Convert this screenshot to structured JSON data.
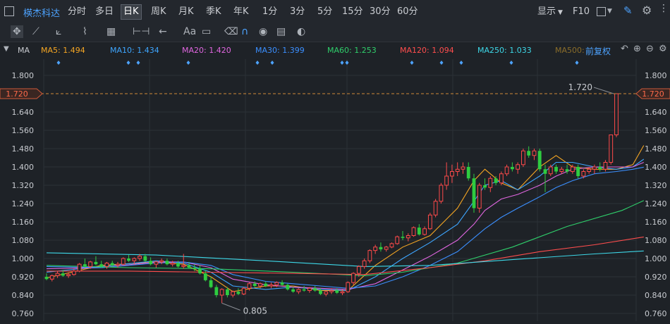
{
  "header": {
    "stock_name": "楧杰科达",
    "periods": [
      "分时",
      "多日",
      "日K",
      "周K",
      "月K",
      "季K",
      "年K",
      "1分",
      "3分",
      "5分",
      "15分",
      "30分",
      "60分"
    ],
    "active_period": "日K",
    "display_label": "显示",
    "f10_label": "F10"
  },
  "toolbar": {
    "text_tool_label": "Aa"
  },
  "indicators": {
    "ma_label": "MA",
    "items": [
      {
        "label": "MA5: 1.494",
        "color": "#f5a623"
      },
      {
        "label": "MA10: 1.434",
        "color": "#3ea6ff"
      },
      {
        "label": "MA20: 1.420",
        "color": "#e066e0"
      },
      {
        "label": "MA30: 1.399",
        "color": "#3b8fff"
      },
      {
        "label": "MA60: 1.253",
        "color": "#2fcf6b"
      },
      {
        "label": "MA120: 1.094",
        "color": "#ff4d4d"
      },
      {
        "label": "MA250: 1.033",
        "color": "#3dd8e8"
      },
      {
        "label": "MA500:",
        "color": "#8a6d2a"
      }
    ],
    "adjust_label": "前复权"
  },
  "chart_data": {
    "type": "candlestick",
    "y_ticks": [
      "1.800",
      "1.720",
      "1.640",
      "1.560",
      "1.480",
      "1.400",
      "1.320",
      "1.240",
      "1.160",
      "1.080",
      "1.000",
      "0.920",
      "0.840",
      "0.760"
    ],
    "ylim": [
      0.755,
      1.83
    ],
    "current_price_label": "1.720",
    "current_price": 1.72,
    "high_label": "1.720",
    "low_label": "0.805",
    "candles": [
      {
        "o": 0.92,
        "h": 0.935,
        "l": 0.905,
        "c": 0.91
      },
      {
        "o": 0.91,
        "h": 0.93,
        "l": 0.9,
        "c": 0.925
      },
      {
        "o": 0.925,
        "h": 0.945,
        "l": 0.915,
        "c": 0.935
      },
      {
        "o": 0.935,
        "h": 0.95,
        "l": 0.92,
        "c": 0.925
      },
      {
        "o": 0.925,
        "h": 0.94,
        "l": 0.915,
        "c": 0.93
      },
      {
        "o": 0.93,
        "h": 0.955,
        "l": 0.925,
        "c": 0.945
      },
      {
        "o": 0.945,
        "h": 0.98,
        "l": 0.94,
        "c": 0.975
      },
      {
        "o": 0.975,
        "h": 1.0,
        "l": 0.96,
        "c": 0.965
      },
      {
        "o": 0.965,
        "h": 0.99,
        "l": 0.955,
        "c": 0.985
      },
      {
        "o": 0.985,
        "h": 1.01,
        "l": 0.97,
        "c": 0.975
      },
      {
        "o": 0.975,
        "h": 0.99,
        "l": 0.96,
        "c": 0.965
      },
      {
        "o": 0.965,
        "h": 0.985,
        "l": 0.955,
        "c": 0.98
      },
      {
        "o": 0.98,
        "h": 0.99,
        "l": 0.965,
        "c": 0.97
      },
      {
        "o": 0.97,
        "h": 0.985,
        "l": 0.96,
        "c": 0.975
      },
      {
        "o": 0.975,
        "h": 1.005,
        "l": 0.97,
        "c": 1.0
      },
      {
        "o": 1.0,
        "h": 1.015,
        "l": 0.985,
        "c": 0.99
      },
      {
        "o": 0.99,
        "h": 1.005,
        "l": 0.975,
        "c": 1.0
      },
      {
        "o": 1.0,
        "h": 1.02,
        "l": 0.99,
        "c": 1.01
      },
      {
        "o": 1.01,
        "h": 1.02,
        "l": 0.985,
        "c": 0.99
      },
      {
        "o": 0.99,
        "h": 1.005,
        "l": 0.97,
        "c": 0.975
      },
      {
        "o": 0.975,
        "h": 0.99,
        "l": 0.96,
        "c": 0.985
      },
      {
        "o": 0.985,
        "h": 1.0,
        "l": 0.975,
        "c": 0.99
      },
      {
        "o": 0.99,
        "h": 1.0,
        "l": 0.97,
        "c": 0.975
      },
      {
        "o": 0.975,
        "h": 0.99,
        "l": 0.965,
        "c": 0.98
      },
      {
        "o": 0.98,
        "h": 0.99,
        "l": 0.96,
        "c": 0.965
      },
      {
        "o": 0.965,
        "h": 1.02,
        "l": 0.955,
        "c": 0.97
      },
      {
        "o": 0.97,
        "h": 0.985,
        "l": 0.955,
        "c": 0.96
      },
      {
        "o": 0.96,
        "h": 0.975,
        "l": 0.945,
        "c": 0.955
      },
      {
        "o": 0.955,
        "h": 0.97,
        "l": 0.93,
        "c": 0.935
      },
      {
        "o": 0.935,
        "h": 0.95,
        "l": 0.9,
        "c": 0.905
      },
      {
        "o": 0.905,
        "h": 0.92,
        "l": 0.87,
        "c": 0.875
      },
      {
        "o": 0.875,
        "h": 0.885,
        "l": 0.83,
        "c": 0.84
      },
      {
        "o": 0.84,
        "h": 0.87,
        "l": 0.805,
        "c": 0.865
      },
      {
        "o": 0.865,
        "h": 0.875,
        "l": 0.83,
        "c": 0.84
      },
      {
        "o": 0.84,
        "h": 0.86,
        "l": 0.83,
        "c": 0.855
      },
      {
        "o": 0.855,
        "h": 0.87,
        "l": 0.84,
        "c": 0.845
      },
      {
        "o": 0.845,
        "h": 0.875,
        "l": 0.84,
        "c": 0.87
      },
      {
        "o": 0.87,
        "h": 0.895,
        "l": 0.86,
        "c": 0.89
      },
      {
        "o": 0.89,
        "h": 0.9,
        "l": 0.875,
        "c": 0.88
      },
      {
        "o": 0.88,
        "h": 0.895,
        "l": 0.87,
        "c": 0.89
      },
      {
        "o": 0.89,
        "h": 0.9,
        "l": 0.875,
        "c": 0.88
      },
      {
        "o": 0.88,
        "h": 0.895,
        "l": 0.87,
        "c": 0.885
      },
      {
        "o": 0.885,
        "h": 0.9,
        "l": 0.875,
        "c": 0.895
      },
      {
        "o": 0.895,
        "h": 0.905,
        "l": 0.88,
        "c": 0.885
      },
      {
        "o": 0.885,
        "h": 0.89,
        "l": 0.86,
        "c": 0.865
      },
      {
        "o": 0.865,
        "h": 0.875,
        "l": 0.85,
        "c": 0.855
      },
      {
        "o": 0.855,
        "h": 0.87,
        "l": 0.845,
        "c": 0.865
      },
      {
        "o": 0.865,
        "h": 0.88,
        "l": 0.855,
        "c": 0.86
      },
      {
        "o": 0.86,
        "h": 0.875,
        "l": 0.85,
        "c": 0.87
      },
      {
        "o": 0.87,
        "h": 0.88,
        "l": 0.855,
        "c": 0.86
      },
      {
        "o": 0.86,
        "h": 0.87,
        "l": 0.84,
        "c": 0.845
      },
      {
        "o": 0.845,
        "h": 0.86,
        "l": 0.835,
        "c": 0.855
      },
      {
        "o": 0.855,
        "h": 0.87,
        "l": 0.845,
        "c": 0.86
      },
      {
        "o": 0.86,
        "h": 0.87,
        "l": 0.845,
        "c": 0.85
      },
      {
        "o": 0.85,
        "h": 0.865,
        "l": 0.84,
        "c": 0.855
      },
      {
        "o": 0.855,
        "h": 0.9,
        "l": 0.85,
        "c": 0.895
      },
      {
        "o": 0.895,
        "h": 0.94,
        "l": 0.885,
        "c": 0.935
      },
      {
        "o": 0.935,
        "h": 0.97,
        "l": 0.92,
        "c": 0.965
      },
      {
        "o": 0.965,
        "h": 1.0,
        "l": 0.955,
        "c": 0.99
      },
      {
        "o": 0.99,
        "h": 1.04,
        "l": 0.98,
        "c": 1.035
      },
      {
        "o": 1.035,
        "h": 1.06,
        "l": 1.02,
        "c": 1.05
      },
      {
        "o": 1.05,
        "h": 1.07,
        "l": 1.03,
        "c": 1.04
      },
      {
        "o": 1.04,
        "h": 1.055,
        "l": 1.03,
        "c": 1.05
      },
      {
        "o": 1.05,
        "h": 1.07,
        "l": 1.045,
        "c": 1.065
      },
      {
        "o": 1.065,
        "h": 1.1,
        "l": 1.06,
        "c": 1.095
      },
      {
        "o": 1.095,
        "h": 1.12,
        "l": 1.08,
        "c": 1.09
      },
      {
        "o": 1.09,
        "h": 1.11,
        "l": 1.075,
        "c": 1.1
      },
      {
        "o": 1.1,
        "h": 1.14,
        "l": 1.095,
        "c": 1.135
      },
      {
        "o": 1.135,
        "h": 1.15,
        "l": 1.1,
        "c": 1.105
      },
      {
        "o": 1.105,
        "h": 1.14,
        "l": 1.1,
        "c": 1.13
      },
      {
        "o": 1.13,
        "h": 1.2,
        "l": 1.125,
        "c": 1.19
      },
      {
        "o": 1.19,
        "h": 1.26,
        "l": 1.18,
        "c": 1.25
      },
      {
        "o": 1.25,
        "h": 1.33,
        "l": 1.24,
        "c": 1.32
      },
      {
        "o": 1.32,
        "h": 1.42,
        "l": 1.3,
        "c": 1.36
      },
      {
        "o": 1.36,
        "h": 1.41,
        "l": 1.33,
        "c": 1.38
      },
      {
        "o": 1.38,
        "h": 1.42,
        "l": 1.36,
        "c": 1.39
      },
      {
        "o": 1.39,
        "h": 1.42,
        "l": 1.37,
        "c": 1.4
      },
      {
        "o": 1.4,
        "h": 1.42,
        "l": 1.34,
        "c": 1.35
      },
      {
        "o": 1.35,
        "h": 1.37,
        "l": 1.2,
        "c": 1.22
      },
      {
        "o": 1.22,
        "h": 1.33,
        "l": 1.2,
        "c": 1.32
      },
      {
        "o": 1.32,
        "h": 1.35,
        "l": 1.3,
        "c": 1.31
      },
      {
        "o": 1.31,
        "h": 1.36,
        "l": 1.29,
        "c": 1.35
      },
      {
        "o": 1.35,
        "h": 1.36,
        "l": 1.32,
        "c": 1.33
      },
      {
        "o": 1.33,
        "h": 1.38,
        "l": 1.32,
        "c": 1.37
      },
      {
        "o": 1.37,
        "h": 1.41,
        "l": 1.36,
        "c": 1.4
      },
      {
        "o": 1.4,
        "h": 1.42,
        "l": 1.38,
        "c": 1.39
      },
      {
        "o": 1.39,
        "h": 1.42,
        "l": 1.37,
        "c": 1.41
      },
      {
        "o": 1.41,
        "h": 1.48,
        "l": 1.4,
        "c": 1.47
      },
      {
        "o": 1.47,
        "h": 1.49,
        "l": 1.44,
        "c": 1.45
      },
      {
        "o": 1.45,
        "h": 1.48,
        "l": 1.43,
        "c": 1.47
      },
      {
        "o": 1.47,
        "h": 1.48,
        "l": 1.38,
        "c": 1.39
      },
      {
        "o": 1.39,
        "h": 1.41,
        "l": 1.29,
        "c": 1.37
      },
      {
        "o": 1.37,
        "h": 1.41,
        "l": 1.36,
        "c": 1.4
      },
      {
        "o": 1.4,
        "h": 1.41,
        "l": 1.37,
        "c": 1.38
      },
      {
        "o": 1.38,
        "h": 1.4,
        "l": 1.37,
        "c": 1.39
      },
      {
        "o": 1.39,
        "h": 1.41,
        "l": 1.37,
        "c": 1.38
      },
      {
        "o": 1.38,
        "h": 1.41,
        "l": 1.37,
        "c": 1.4
      },
      {
        "o": 1.4,
        "h": 1.41,
        "l": 1.35,
        "c": 1.36
      },
      {
        "o": 1.36,
        "h": 1.39,
        "l": 1.35,
        "c": 1.38
      },
      {
        "o": 1.38,
        "h": 1.4,
        "l": 1.37,
        "c": 1.39
      },
      {
        "o": 1.39,
        "h": 1.41,
        "l": 1.37,
        "c": 1.4
      },
      {
        "o": 1.4,
        "h": 1.42,
        "l": 1.38,
        "c": 1.39
      },
      {
        "o": 1.39,
        "h": 1.43,
        "l": 1.38,
        "c": 1.42
      },
      {
        "o": 1.42,
        "h": 1.54,
        "l": 1.41,
        "c": 1.54
      },
      {
        "o": 1.54,
        "h": 1.72,
        "l": 1.53,
        "c": 1.72
      }
    ],
    "ma_series": [
      {
        "name": "MA5",
        "points": [
          [
            0,
            0.915
          ],
          [
            10,
            0.97
          ],
          [
            20,
            0.985
          ],
          [
            25,
            0.975
          ],
          [
            30,
            0.92
          ],
          [
            34,
            0.855
          ],
          [
            40,
            0.88
          ],
          [
            45,
            0.88
          ],
          [
            50,
            0.86
          ],
          [
            55,
            0.86
          ],
          [
            60,
            0.97
          ],
          [
            65,
            1.05
          ],
          [
            70,
            1.1
          ],
          [
            75,
            1.22
          ],
          [
            78,
            1.34
          ],
          [
            80,
            1.39
          ],
          [
            83,
            1.33
          ],
          [
            86,
            1.3
          ],
          [
            90,
            1.4
          ],
          [
            93,
            1.45
          ],
          [
            96,
            1.4
          ],
          [
            100,
            1.39
          ],
          [
            104,
            1.39
          ],
          [
            107,
            1.41
          ],
          [
            109,
            1.494
          ]
        ]
      },
      {
        "name": "MA10",
        "points": [
          [
            0,
            0.94
          ],
          [
            10,
            0.965
          ],
          [
            20,
            0.99
          ],
          [
            25,
            0.98
          ],
          [
            30,
            0.94
          ],
          [
            34,
            0.88
          ],
          [
            40,
            0.865
          ],
          [
            45,
            0.875
          ],
          [
            50,
            0.865
          ],
          [
            55,
            0.86
          ],
          [
            60,
            0.92
          ],
          [
            65,
            1.0
          ],
          [
            70,
            1.07
          ],
          [
            75,
            1.15
          ],
          [
            78,
            1.25
          ],
          [
            80,
            1.32
          ],
          [
            83,
            1.34
          ],
          [
            86,
            1.3
          ],
          [
            90,
            1.36
          ],
          [
            93,
            1.42
          ],
          [
            96,
            1.42
          ],
          [
            100,
            1.4
          ],
          [
            104,
            1.39
          ],
          [
            107,
            1.4
          ],
          [
            109,
            1.434
          ]
        ]
      },
      {
        "name": "MA20",
        "points": [
          [
            0,
            0.955
          ],
          [
            10,
            0.96
          ],
          [
            20,
            0.985
          ],
          [
            25,
            0.985
          ],
          [
            30,
            0.96
          ],
          [
            34,
            0.91
          ],
          [
            40,
            0.885
          ],
          [
            45,
            0.875
          ],
          [
            50,
            0.87
          ],
          [
            55,
            0.865
          ],
          [
            60,
            0.89
          ],
          [
            65,
            0.95
          ],
          [
            70,
            1.01
          ],
          [
            75,
            1.08
          ],
          [
            78,
            1.15
          ],
          [
            80,
            1.21
          ],
          [
            83,
            1.26
          ],
          [
            86,
            1.28
          ],
          [
            90,
            1.32
          ],
          [
            93,
            1.36
          ],
          [
            96,
            1.39
          ],
          [
            100,
            1.4
          ],
          [
            104,
            1.4
          ],
          [
            107,
            1.4
          ],
          [
            109,
            1.42
          ]
        ]
      },
      {
        "name": "MA30",
        "points": [
          [
            0,
            0.965
          ],
          [
            10,
            0.96
          ],
          [
            20,
            0.98
          ],
          [
            25,
            0.985
          ],
          [
            30,
            0.97
          ],
          [
            34,
            0.93
          ],
          [
            40,
            0.9
          ],
          [
            45,
            0.89
          ],
          [
            50,
            0.88
          ],
          [
            55,
            0.87
          ],
          [
            60,
            0.88
          ],
          [
            65,
            0.92
          ],
          [
            70,
            0.97
          ],
          [
            75,
            1.03
          ],
          [
            78,
            1.09
          ],
          [
            80,
            1.13
          ],
          [
            83,
            1.18
          ],
          [
            86,
            1.22
          ],
          [
            90,
            1.27
          ],
          [
            93,
            1.31
          ],
          [
            96,
            1.34
          ],
          [
            100,
            1.37
          ],
          [
            104,
            1.38
          ],
          [
            107,
            1.39
          ],
          [
            109,
            1.399
          ]
        ]
      },
      {
        "name": "MA60",
        "points": [
          [
            0,
            0.97
          ],
          [
            15,
            0.96
          ],
          [
            30,
            0.955
          ],
          [
            45,
            0.94
          ],
          [
            58,
            0.925
          ],
          [
            65,
            0.94
          ],
          [
            75,
            0.98
          ],
          [
            85,
            1.05
          ],
          [
            95,
            1.14
          ],
          [
            105,
            1.21
          ],
          [
            109,
            1.253
          ]
        ]
      },
      {
        "name": "MA120",
        "points": [
          [
            0,
            0.945
          ],
          [
            15,
            0.945
          ],
          [
            30,
            0.94
          ],
          [
            45,
            0.935
          ],
          [
            58,
            0.93
          ],
          [
            70,
            0.96
          ],
          [
            80,
            0.99
          ],
          [
            90,
            1.03
          ],
          [
            100,
            1.06
          ],
          [
            109,
            1.094
          ]
        ]
      },
      {
        "name": "MA250",
        "points": [
          [
            0,
            1.025
          ],
          [
            20,
            1.015
          ],
          [
            40,
            0.99
          ],
          [
            58,
            0.965
          ],
          [
            70,
            0.97
          ],
          [
            85,
            0.995
          ],
          [
            100,
            1.02
          ],
          [
            109,
            1.033
          ]
        ]
      }
    ]
  }
}
